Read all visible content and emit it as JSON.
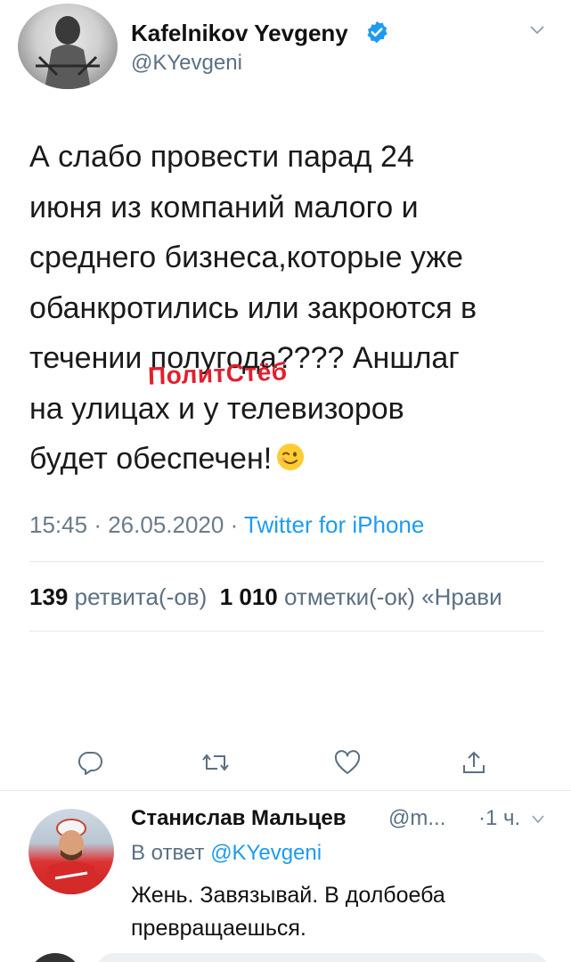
{
  "tweet": {
    "author_name": "Kafelnikov Yevgeny",
    "handle": "@KYevgeni",
    "text_lines": [
      "А слабо провести парад 24",
      "июня из компаний малого и",
      "среднего бизнеса,которые уже",
      "обанкротились или закроются в",
      "течении полугода???? Аншлаг",
      "на улицах и у телевизоров",
      "будет обеспечен!"
    ],
    "emoji": "winking-face",
    "time": "15:45",
    "date": "26.05.2020",
    "source": "Twitter for iPhone",
    "separator": "·"
  },
  "watermark": "ПолитСтёб",
  "stats": {
    "retweets_count": "139",
    "retweets_label": "ретвита(-ов)",
    "likes_count": "1 010",
    "likes_label": "отметки(-ок)",
    "quote_label": "«Нрави"
  },
  "actions": [
    "reply-icon",
    "retweet-icon",
    "like-icon",
    "share-icon"
  ],
  "reply": {
    "author_name": "Станислав Мальцев",
    "handle": "@m...",
    "time": "·1 ч.",
    "reply_to_prefix": "В ответ",
    "reply_to_handle": "@KYevgeni",
    "text": "Жень. Завязывай. В долбоеба превращаешься."
  },
  "colors": {
    "accent": "#1d9bf0",
    "secondary_text": "#5b7083",
    "watermark": "#e0202e"
  }
}
